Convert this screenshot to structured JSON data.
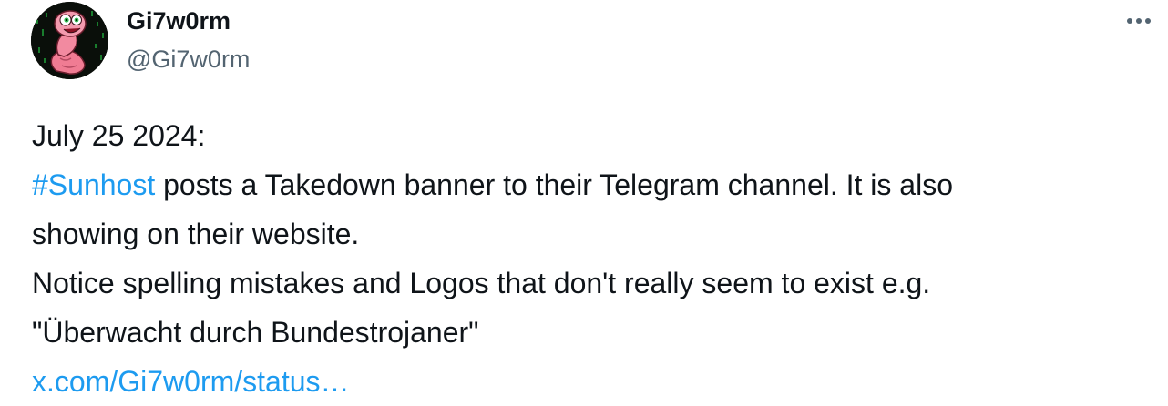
{
  "author": {
    "display_name": "Gi7w0rm",
    "handle": "@Gi7w0rm",
    "avatar_icon": "pink-worm-matrix-avatar"
  },
  "menu": {
    "icon": "more-horizontal-icon"
  },
  "tweet": {
    "line1": "July 25 2024:",
    "hashtag": "#Sunhost",
    "line2_rest": " posts a Takedown banner to their Telegram channel. It is also",
    "line3": "showing on their website.",
    "line4": "Notice spelling mistakes and Logos that don't really seem to exist e.g.",
    "line5": "\"Überwacht durch Bundestrojaner\"",
    "link": "x.com/Gi7w0rm/status…"
  },
  "colors": {
    "text": "#0f1419",
    "secondary": "#536471",
    "link": "#1d9bf0"
  }
}
